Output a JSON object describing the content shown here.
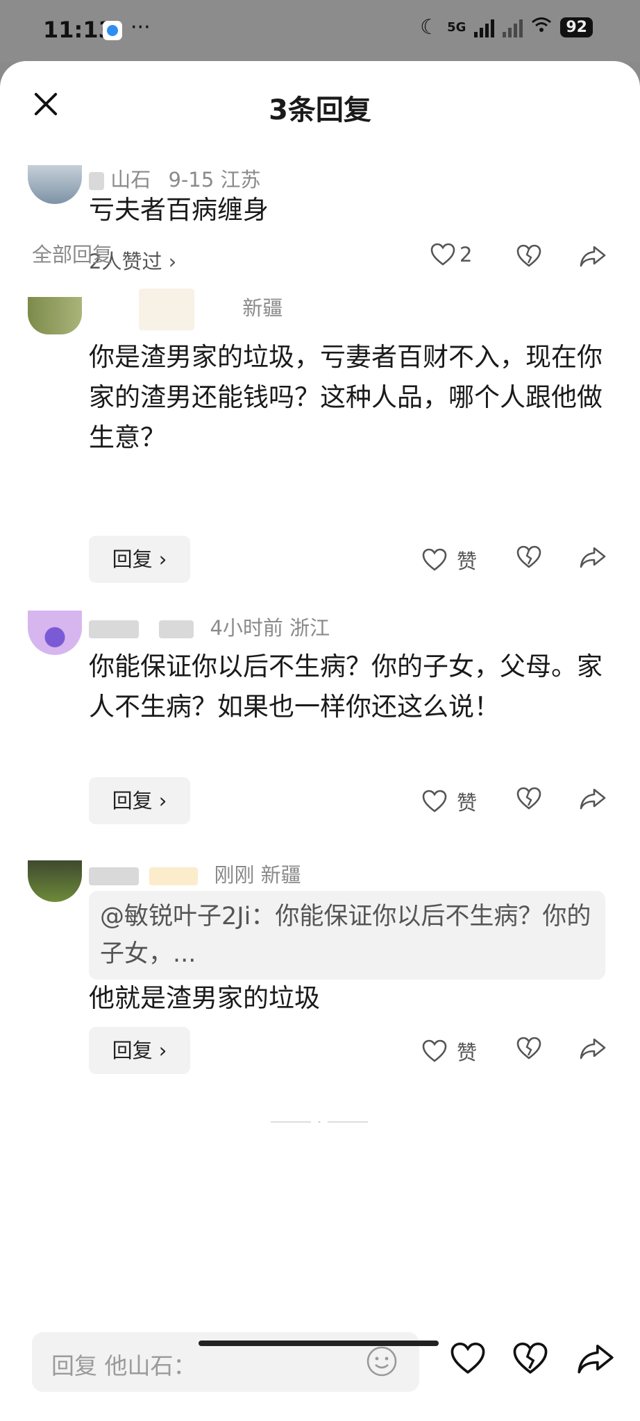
{
  "status_bar": {
    "time": "11:13",
    "more": "···",
    "signal_label": "5G",
    "battery": "92"
  },
  "header": {
    "title": "3条回复",
    "close_icon": "close-icon"
  },
  "root_comment": {
    "meta": "9-15  江苏",
    "name_partial": "山石",
    "text": "亏夫者百病缠身",
    "likers": "2人赞过 ›",
    "like_count": "2"
  },
  "section_label": "全部回复",
  "replies": [
    {
      "location": "新疆",
      "text": "你是渣男家的垃圾，亏妻者百财不入，现在你家的渣男还能钱吗？这种人品，哪个人跟他做生意？",
      "reply_label": "回复 ›",
      "like_label": "赞"
    },
    {
      "meta": "4小时前  浙江",
      "text": "你能保证你以后不生病？你的子女，父母。家人不生病？如果也一样你还这么说！",
      "reply_label": "回复 ›",
      "like_label": "赞"
    },
    {
      "meta": "刚刚  新疆",
      "quote": "@敏锐叶子2Ji：你能保证你以后不生病？你的子女，...",
      "text": "他就是渣男家的垃圾",
      "reply_label": "回复 ›",
      "like_label": "赞"
    }
  ],
  "input": {
    "placeholder": "回复 他山石："
  },
  "colors": {
    "status_bg": "#8c8c8c",
    "sheet_bg": "#ffffff",
    "muted": "#8a8a8a",
    "chip_bg": "#f2f2f2"
  }
}
